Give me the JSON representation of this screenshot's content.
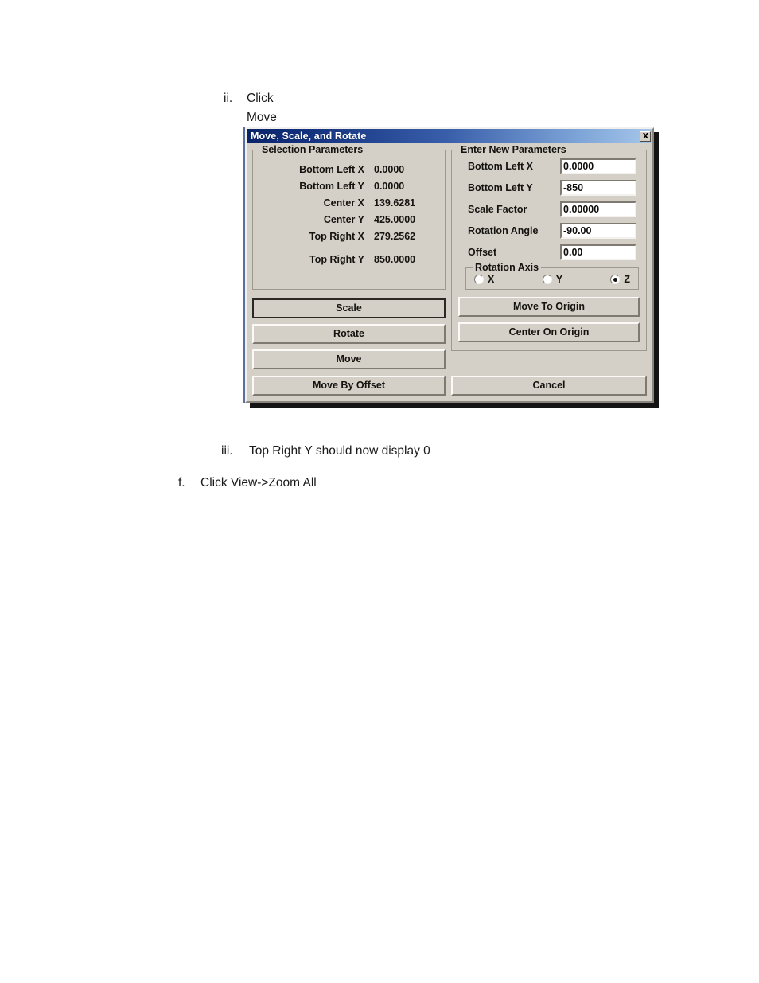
{
  "document": {
    "steps": [
      {
        "marker": "ii.",
        "lines": [
          "Click",
          "Move"
        ]
      },
      {
        "marker": "iii.",
        "lines": [
          "Top Right Y should now display 0"
        ]
      },
      {
        "marker": "f.",
        "lines": [
          "Click View->Zoom All"
        ]
      }
    ],
    "step_ii_marker": "ii.",
    "step_ii_line1": "Click",
    "step_ii_line2": "Move",
    "step_iii_marker": "iii.",
    "step_iii_text": "Top Right Y should now display 0",
    "step_f_marker": "f.",
    "step_f_text": "Click View->Zoom All"
  },
  "dialog": {
    "title": "Move, Scale, and Rotate",
    "close_icon": "close-icon",
    "titlebar_gradient_start": "#0a246a",
    "titlebar_gradient_end": "#a6c6ea",
    "face_color": "#d4d0c8",
    "selection_parameters": {
      "legend": "Selection Parameters",
      "rows": [
        {
          "label": "Bottom Left X",
          "value": "0.0000"
        },
        {
          "label": "Bottom Left Y",
          "value": "0.0000"
        },
        {
          "label": "Center X",
          "value": "139.6281"
        },
        {
          "label": "Center Y",
          "value": "425.0000"
        },
        {
          "label": "Top Right X",
          "value": "279.2562"
        },
        {
          "label": "Top Right Y",
          "value": "850.0000"
        }
      ]
    },
    "enter_new_parameters": {
      "legend": "Enter New Parameters",
      "fields": [
        {
          "label": "Bottom Left X",
          "value": "0.0000"
        },
        {
          "label": "Bottom Left Y",
          "value": "-850"
        },
        {
          "label": "Scale Factor",
          "value": "0.00000"
        },
        {
          "label": "Rotation Angle",
          "value": "-90.00"
        },
        {
          "label": "Offset",
          "value": "0.00"
        }
      ]
    },
    "rotation_axis": {
      "legend": "Rotation Axis",
      "options": [
        {
          "label": "X",
          "selected": false
        },
        {
          "label": "Y",
          "selected": false
        },
        {
          "label": "Z",
          "selected": true
        }
      ],
      "selected": "Z"
    },
    "buttons": {
      "scale": "Scale",
      "rotate": "Rotate",
      "move": "Move",
      "move_by_offset": "Move By Offset",
      "move_to_origin": "Move To Origin",
      "center_on_origin": "Center On Origin",
      "cancel": "Cancel",
      "focused": "Scale"
    }
  }
}
